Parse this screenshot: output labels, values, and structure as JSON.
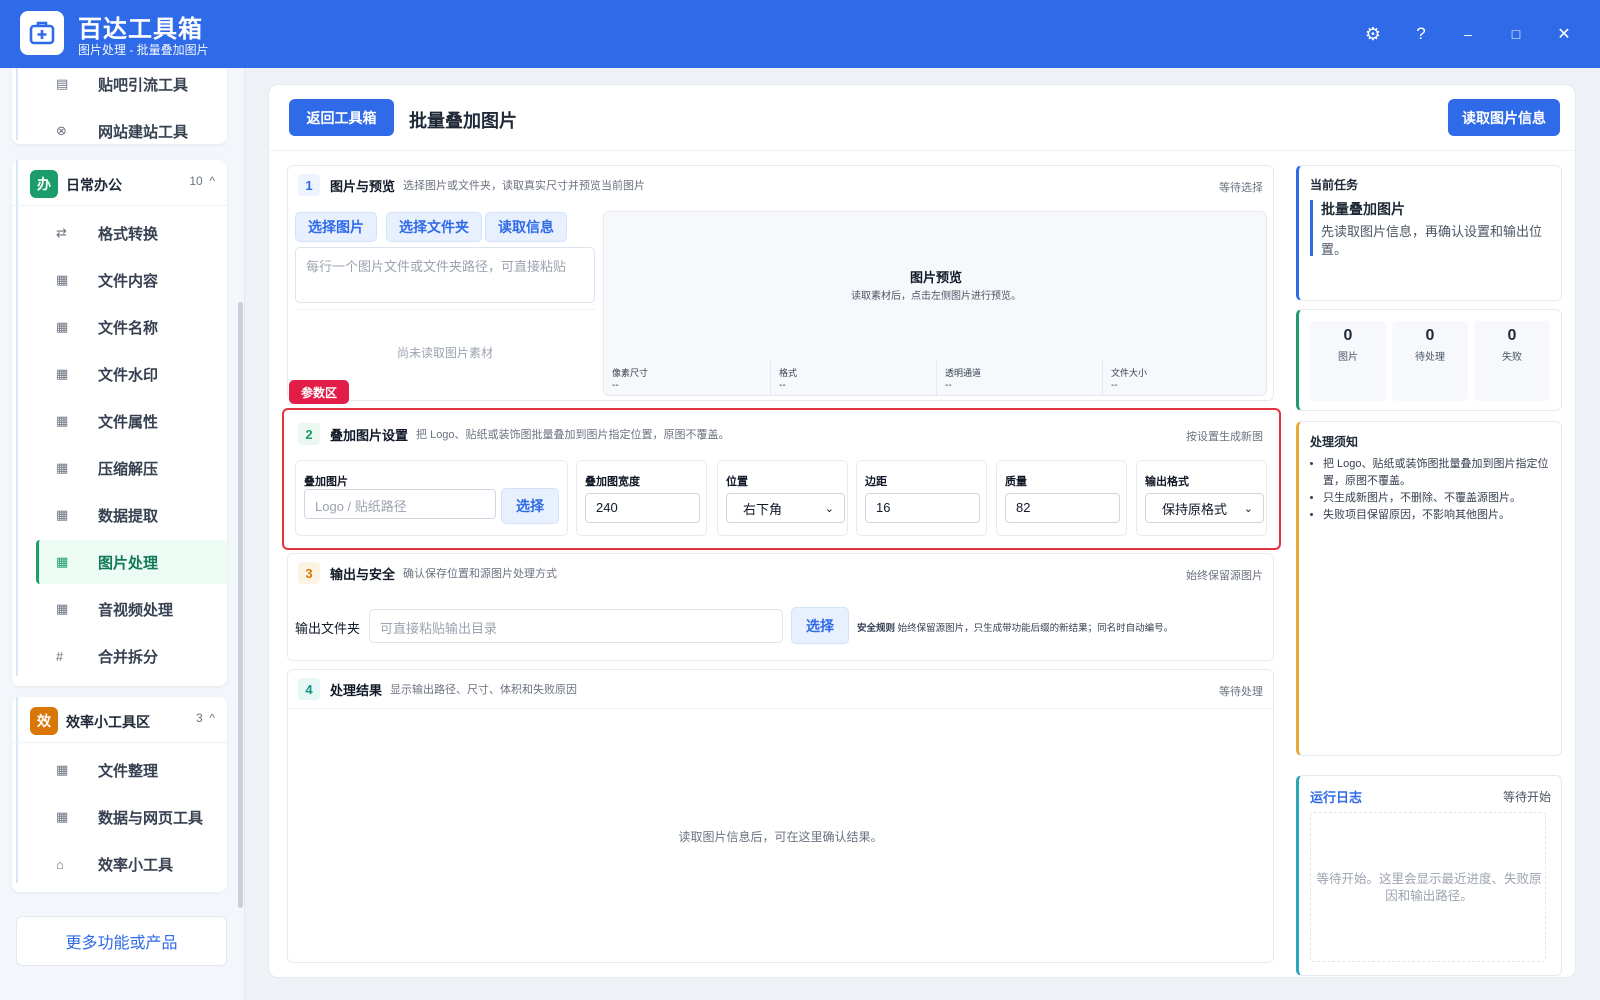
{
  "app": {
    "title": "百达工具箱",
    "subtitle": "图片处理 - 批量叠加图片"
  },
  "window": {
    "settings": "⚙",
    "help": "?",
    "minimize": "–",
    "maximize": "□",
    "close": "✕"
  },
  "sidebar": {
    "top_items": [
      {
        "icon": "▤",
        "label": "贴吧引流工具"
      },
      {
        "icon": "⊗",
        "label": "网站建站工具"
      }
    ],
    "groups": [
      {
        "badge": "办",
        "badge_color": "#1a9d6a",
        "name": "日常办公",
        "count": "10",
        "chevron": "^",
        "items": [
          {
            "icon": "⇄",
            "label": "格式转换"
          },
          {
            "icon": "▦",
            "label": "文件内容"
          },
          {
            "icon": "▦",
            "label": "文件名称"
          },
          {
            "icon": "▦",
            "label": "文件水印"
          },
          {
            "icon": "▦",
            "label": "文件属性"
          },
          {
            "icon": "▦",
            "label": "压缩解压"
          },
          {
            "icon": "▦",
            "label": "数据提取"
          },
          {
            "icon": "▦",
            "label": "图片处理"
          },
          {
            "icon": "▦",
            "label": "音视频处理"
          },
          {
            "icon": "#",
            "label": "合并拆分"
          }
        ]
      },
      {
        "badge": "效",
        "badge_color": "#d97706",
        "name": "效率小工具区",
        "count": "3",
        "chevron": "^",
        "items": [
          {
            "icon": "▦",
            "label": "文件整理"
          },
          {
            "icon": "▦",
            "label": "数据与网页工具"
          },
          {
            "icon": "⌂",
            "label": "效率小工具"
          }
        ]
      }
    ],
    "more_label": "更多功能或产品"
  },
  "header": {
    "back_label": "返回工具箱",
    "title": "批量叠加图片",
    "read_info_label": "读取图片信息"
  },
  "section1": {
    "num": "1",
    "title": "图片与预览",
    "desc": "选择图片或文件夹，读取真实尺寸并预览当前图片",
    "status": "等待选择",
    "buttons": [
      "选择图片",
      "选择文件夹",
      "读取信息"
    ],
    "path_placeholder": "每行一个图片文件或文件夹路径，可直接粘贴",
    "empty_text": "尚未读取图片素材",
    "preview_title": "图片预览",
    "preview_hint": "读取素材后，点击左侧图片进行预览。",
    "meta": [
      {
        "k": "像素尺寸",
        "v": "--"
      },
      {
        "k": "格式",
        "v": "--"
      },
      {
        "k": "透明通道",
        "v": "--"
      },
      {
        "k": "文件大小",
        "v": "--"
      }
    ]
  },
  "param_tag": "参数区",
  "section2": {
    "num": "2",
    "title": "叠加图片设置",
    "desc": "把 Logo、贴纸或装饰图批量叠加到图片指定位置，原图不覆盖。",
    "status": "按设置生成新图",
    "overlay_label": "叠加图片",
    "overlay_placeholder": "Logo / 贴纸路径",
    "choose_label": "选择",
    "width_label": "叠加图宽度",
    "width_value": "240",
    "position_label": "位置",
    "position_value": "右下角",
    "margin_label": "边距",
    "margin_value": "16",
    "quality_label": "质量",
    "quality_value": "82",
    "format_label": "输出格式",
    "format_value": "保持原格式"
  },
  "section3": {
    "num": "3",
    "title": "输出与安全",
    "desc": "确认保存位置和源图片处理方式",
    "status": "始终保留源图片",
    "folder_label": "输出文件夹",
    "folder_placeholder": "可直接粘贴输出目录",
    "choose_label": "选择",
    "rule_title": "安全规则",
    "rule_text": "始终保留源图片，只生成带功能后缀的新结果；同名时自动编号。"
  },
  "section4": {
    "num": "4",
    "title": "处理结果",
    "desc": "显示输出路径、尺寸、体积和失败原因",
    "status": "等待处理",
    "empty_text": "读取图片信息后，可在这里确认结果。"
  },
  "right": {
    "task_label": "当前任务",
    "task_title": "批量叠加图片",
    "task_desc": "先读取图片信息，再确认设置和输出位置。",
    "stats": [
      {
        "n": "0",
        "l": "图片"
      },
      {
        "n": "0",
        "l": "待处理"
      },
      {
        "n": "0",
        "l": "失败"
      }
    ],
    "notice_title": "处理须知",
    "notices": [
      "把 Logo、贴纸或装饰图批量叠加到图片指定位置，原图不覆盖。",
      "只生成新图片，不删除、不覆盖源图片。",
      "失败项目保留原因，不影响其他图片。"
    ],
    "log_title": "运行日志",
    "log_status": "等待开始",
    "log_text": "等待开始。这里会显示最近进度、失败原因和输出路径。"
  }
}
